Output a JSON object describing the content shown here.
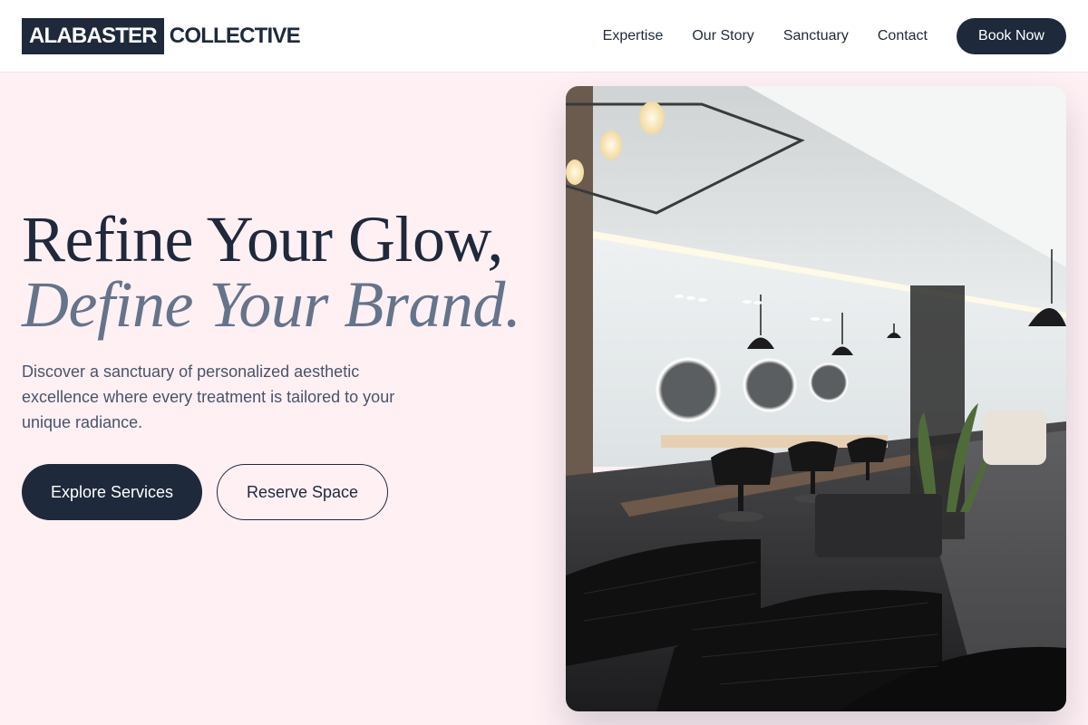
{
  "brand": {
    "logo_box": "ALABASTER",
    "logo_rest": "COLLECTIVE"
  },
  "nav": {
    "items": [
      {
        "label": "Expertise"
      },
      {
        "label": "Our Story"
      },
      {
        "label": "Sanctuary"
      },
      {
        "label": "Contact"
      }
    ],
    "cta_label": "Book Now"
  },
  "hero": {
    "title_line1": "Refine Your Glow,",
    "title_line2": "Define Your Brand.",
    "description": "Discover a sanctuary of personalized aesthetic excellence where every treatment is tailored to your unique radiance.",
    "primary_button": "Explore Services",
    "secondary_button": "Reserve Space",
    "image_subject": "salon-interior-photo"
  },
  "colors": {
    "background": "#fff0f4",
    "header": "#ffffff",
    "navy": "#1e293b",
    "slate_italic": "#64748b",
    "body_text": "#475569"
  }
}
